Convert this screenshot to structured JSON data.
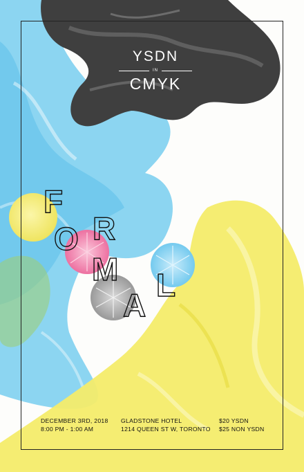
{
  "brand": {
    "top": "YSDN",
    "middle": "IN",
    "bottom": "CMYK"
  },
  "title_letters": [
    "F",
    "O",
    "R",
    "M",
    "A",
    "L"
  ],
  "event": {
    "date": "DECEMBER 3RD, 2018",
    "time": "8:00 PM - 1:00 AM",
    "venue": "GLADSTONE HOTEL",
    "address": "1214 QUEEN ST W, TORONTO",
    "price_member": "$20 YSDN",
    "price_non_member": "$25 NON YSDN"
  },
  "colors": {
    "cyan": "#79cdef",
    "yellow": "#f4ec6a",
    "black_ink": "#3a3a3a",
    "magenta": "#ef6a9c",
    "frame": "#222222"
  }
}
